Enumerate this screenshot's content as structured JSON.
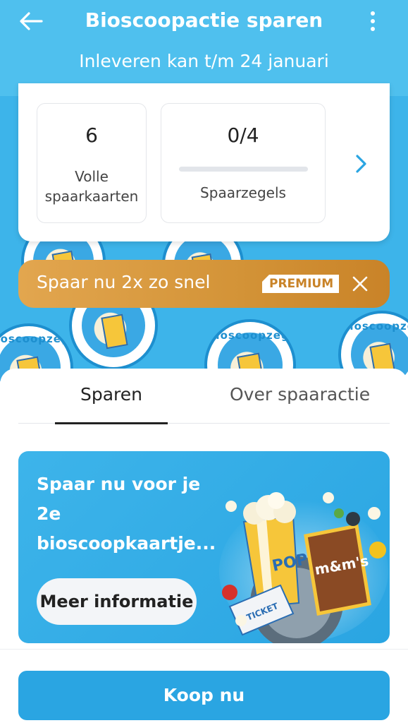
{
  "header": {
    "title": "Bioscoopactie sparen",
    "subtitle": "Inleveren kan t/m 24 januari",
    "back_icon": "arrow-left-icon",
    "menu_icon": "more-vertical-icon"
  },
  "summary": {
    "full_cards": {
      "value": "6",
      "label": "Volle spaarkaarten"
    },
    "stamps": {
      "value": "0/4",
      "label": "Spaarzegels",
      "progress": 0
    },
    "next_icon": "chevron-right-icon"
  },
  "background_stamps": {
    "ring_text": "Bioscoopzegel"
  },
  "premium_banner": {
    "text": "Spaar nu 2x zo snel",
    "badge": "PREMIUM",
    "close_icon": "close-icon"
  },
  "tabs": [
    {
      "label": "Sparen",
      "active": true
    },
    {
      "label": "Over spaaractie",
      "active": false
    }
  ],
  "promo": {
    "text": "Spaar nu voor je 2e bioscoopkaartje...",
    "button_label": "Meer informatie",
    "art": {
      "popcorn_label": "POP",
      "candy_label": "m&m's",
      "ticket_label": "TICKET"
    }
  },
  "buy_button": {
    "label": "Koop nu"
  },
  "colors": {
    "primary": "#2aa5e2",
    "header": "#4fc0ee",
    "premium": "#d39337"
  }
}
